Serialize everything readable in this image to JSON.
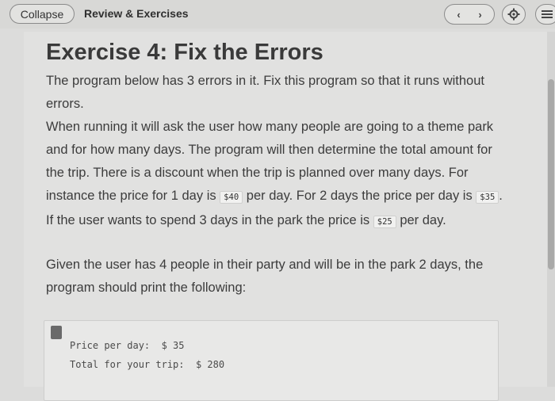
{
  "header": {
    "collapse_label": "Collapse",
    "section_title": "Review & Exercises",
    "prev_icon": "chevron-left-icon",
    "next_icon": "chevron-right-icon",
    "settings_icon": "gear-icon",
    "menu_icon": "list-icon"
  },
  "exercise": {
    "title": "Exercise 4: Fix the Errors",
    "para1": "The program below has 3 errors in it. Fix this program so that it runs without errors.",
    "para2_a": "When running it will ask the user how many people are going to a theme park and for how many days. The program will then determine the total amount for the trip. There is a discount when the trip is planned over many days. For instance the price for 1 day is",
    "code_40": "$40",
    "para2_b": "per day. For 2 days the price per day is",
    "code_35": "$35",
    "para2_c": ". If the user wants to spend 3 days in the park the price is",
    "code_25": "$25",
    "para2_d": "per day.",
    "para3": "Given the user has 4 people in their party and will be in the park 2 days, the program should print the following:"
  },
  "output": {
    "line1": "Price per day:  $ 35",
    "line2": "Total for your trip:  $ 280"
  }
}
